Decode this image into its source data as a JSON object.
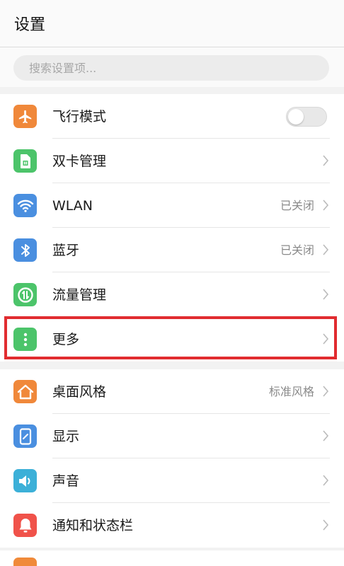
{
  "header": {
    "title": "设置"
  },
  "search": {
    "placeholder": "搜索设置项..."
  },
  "colors": {
    "accent_highlight": "#e12c30",
    "orange": "#f0883a",
    "green": "#4cc46a",
    "blue": "#4a8fe0",
    "cyan": "#3cb0d8",
    "red": "#f0524a"
  },
  "network_group": [
    {
      "label": "飞行模式",
      "icon": "airplane-icon",
      "control": "toggle",
      "toggle_on": false
    },
    {
      "label": "双卡管理",
      "icon": "sim-card-icon",
      "control": "chevron"
    },
    {
      "label": "WLAN",
      "icon": "wifi-icon",
      "value": "已关闭",
      "control": "chevron"
    },
    {
      "label": "蓝牙",
      "icon": "bluetooth-icon",
      "value": "已关闭",
      "control": "chevron"
    },
    {
      "label": "流量管理",
      "icon": "data-usage-icon",
      "control": "chevron"
    },
    {
      "label": "更多",
      "icon": "more-icon",
      "control": "chevron",
      "highlighted": true
    }
  ],
  "device_group": [
    {
      "label": "桌面风格",
      "icon": "home-icon",
      "value": "标准风格",
      "control": "chevron"
    },
    {
      "label": "显示",
      "icon": "display-icon",
      "control": "chevron"
    },
    {
      "label": "声音",
      "icon": "speaker-icon",
      "control": "chevron"
    },
    {
      "label": "通知和状态栏",
      "icon": "bell-icon",
      "control": "chevron"
    }
  ]
}
